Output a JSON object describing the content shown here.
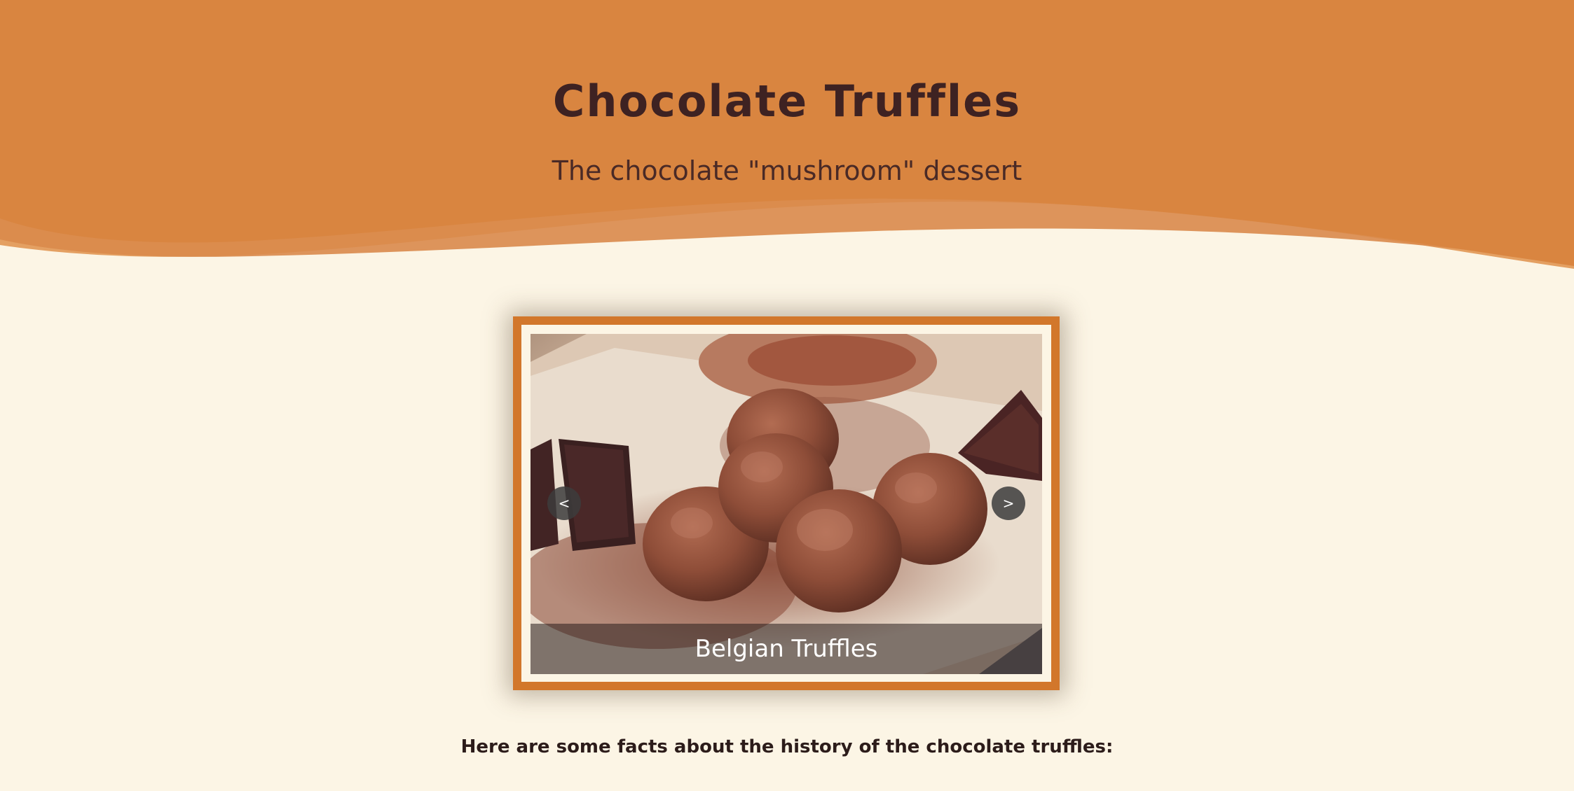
{
  "header": {
    "title": "Chocolate Truffles",
    "subtitle": "The chocolate \"mushroom\" dessert"
  },
  "slideshow": {
    "prev_label": "<",
    "next_label": ">",
    "current_caption": "Belgian Truffles",
    "current_image": "cocoa-dusted-chocolate-truffles-photo"
  },
  "content": {
    "facts_intro": "Here are some facts about the history of the chocolate truffles:"
  },
  "colors": {
    "header_orange": "#d98540",
    "page_cream": "#fcf5e5",
    "frame_orange": "#d2772b",
    "title_brown": "#3e2222"
  }
}
